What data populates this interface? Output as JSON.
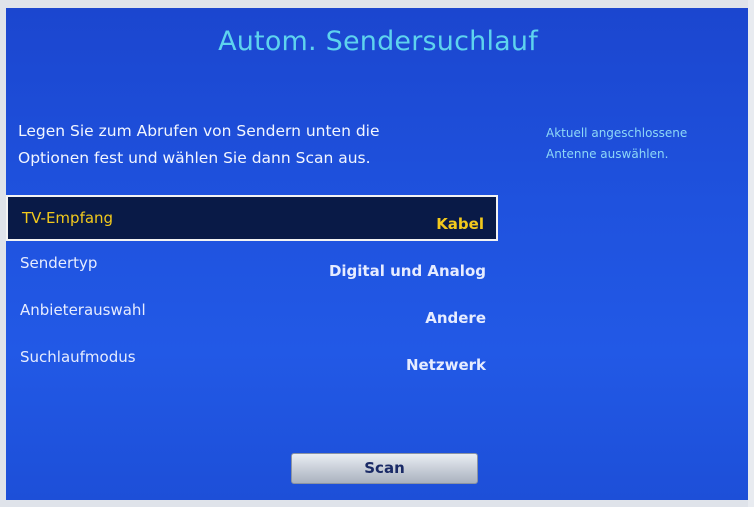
{
  "screen": {
    "title": "Autom. Sendersuchlauf"
  },
  "instructions": {
    "line1": "Legen Sie zum Abrufen von Sendern unten die",
    "line2": "Optionen fest und wählen Sie dann Scan aus."
  },
  "help": {
    "line1": "Aktuell angeschlossene",
    "line2": "Antenne auswählen."
  },
  "menu": {
    "items": [
      {
        "label": "TV-Empfang",
        "value": "Kabel",
        "selected": true
      },
      {
        "label": "Sendertyp",
        "value": "Digital und Analog",
        "selected": false
      },
      {
        "label": "Anbieterauswahl",
        "value": "Andere",
        "selected": false
      },
      {
        "label": "Suchlaufmodus",
        "value": "Netzwerk",
        "selected": false
      }
    ]
  },
  "buttons": {
    "scan_label": "Scan"
  },
  "colors": {
    "background": "#1f52de",
    "title": "#5ed3ee",
    "selected_text": "#f2c91c",
    "help_text": "#8ed8f7",
    "selected_bg": "#091a47"
  }
}
